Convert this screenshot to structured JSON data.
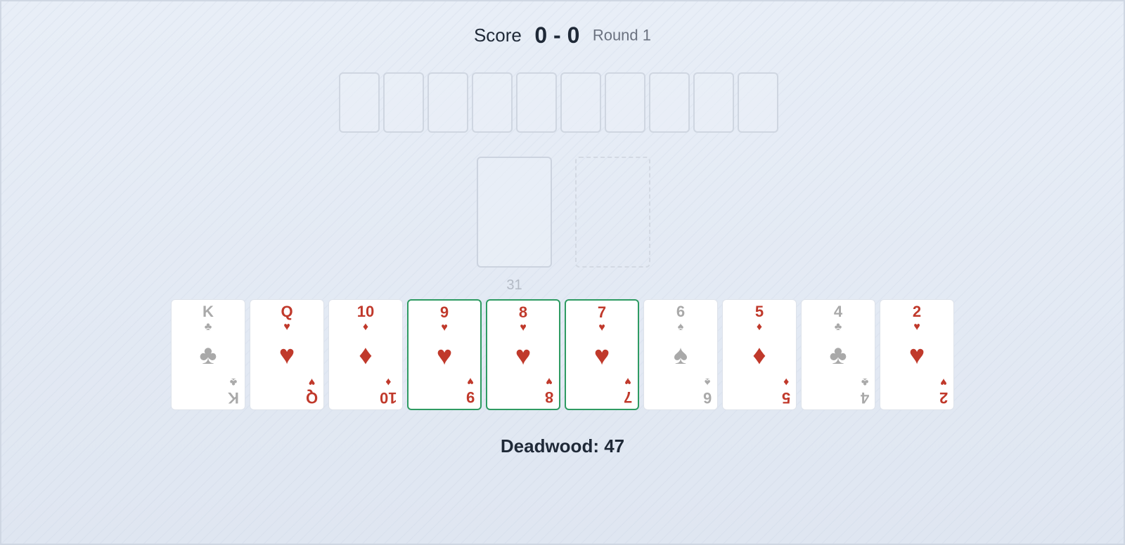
{
  "header": {
    "score_label": "Score",
    "score_value": "0 - 0",
    "round_label": "Round 1"
  },
  "opponent": {
    "card_slots": 10
  },
  "stock": {
    "count": "31"
  },
  "hand": [
    {
      "rank": "K",
      "suit": "♣",
      "color": "gray",
      "selected": false,
      "name": "card-king-clubs"
    },
    {
      "rank": "Q",
      "suit": "♥",
      "color": "red",
      "selected": false,
      "name": "card-queen-hearts"
    },
    {
      "rank": "10",
      "suit": "♦",
      "color": "red",
      "selected": false,
      "name": "card-10-diamonds"
    },
    {
      "rank": "9",
      "suit": "♥",
      "color": "red",
      "selected": true,
      "name": "card-9-hearts"
    },
    {
      "rank": "8",
      "suit": "♥",
      "color": "red",
      "selected": true,
      "name": "card-8-hearts"
    },
    {
      "rank": "7",
      "suit": "♥",
      "color": "red",
      "selected": true,
      "name": "card-7-hearts"
    },
    {
      "rank": "6",
      "suit": "♠",
      "color": "gray",
      "selected": false,
      "name": "card-6-spades"
    },
    {
      "rank": "5",
      "suit": "♦",
      "color": "red",
      "selected": false,
      "name": "card-5-diamonds"
    },
    {
      "rank": "4",
      "suit": "♣",
      "color": "gray",
      "selected": false,
      "name": "card-4-clubs"
    },
    {
      "rank": "2",
      "suit": "♥",
      "color": "red",
      "selected": false,
      "name": "card-2-hearts"
    }
  ],
  "footer": {
    "deadwood_label": "Deadwood: 47"
  },
  "colors": {
    "red_suit": "#c0392b",
    "black_suit_dimmed": "#a9a9a9",
    "meld_highlight": "#2e9b62",
    "background": "#e6ecf5"
  }
}
